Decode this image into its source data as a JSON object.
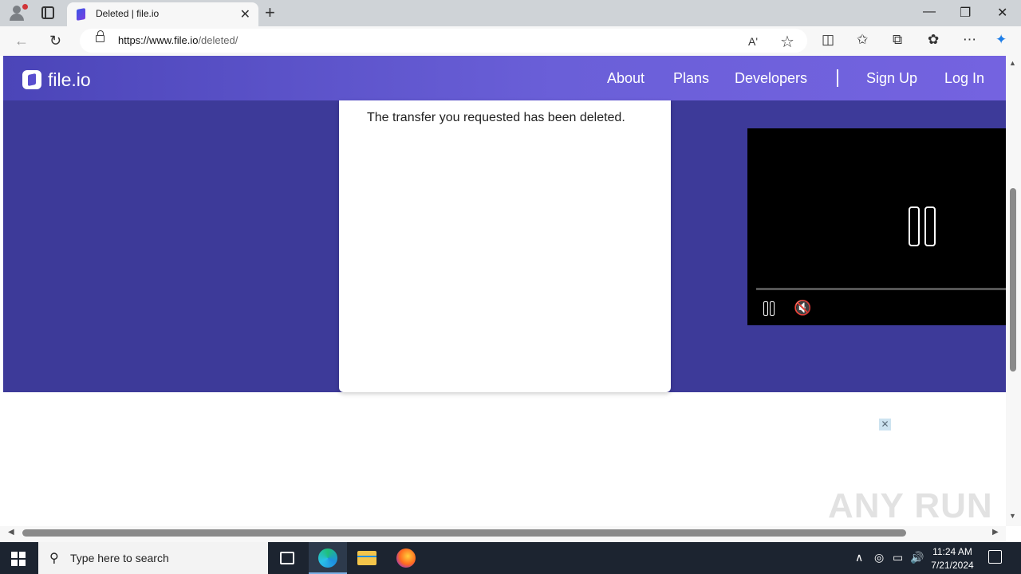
{
  "browser": {
    "tab_title": "Deleted | file.io",
    "tab_close": "✕",
    "new_tab": "+",
    "url_host": "https://www.file.io",
    "url_path": "/deleted/",
    "window_controls": {
      "minimize": "—",
      "restore": "❐",
      "close": "✕"
    },
    "nav": {
      "back": "←",
      "refresh": "↻"
    },
    "toolbar_icons": {
      "read_aloud": "Aʹ",
      "favorite": "☆",
      "split": "◫",
      "favorites": "✩",
      "collections": "⧉",
      "extensions": "✿",
      "menu": "⋯",
      "copilot": "✦"
    }
  },
  "site": {
    "logo_text": "file.io",
    "nav": {
      "about": "About",
      "plans": "Plans",
      "developers": "Developers",
      "signup": "Sign Up",
      "login": "Log In"
    },
    "message": "The transfer you requested has been deleted.",
    "ad_close": "✕",
    "watermark": "ANY RUN"
  },
  "video": {
    "state": "paused",
    "muted": true,
    "mute_icon": "🔇"
  },
  "scrollbar": {
    "up": "▲",
    "down": "▼",
    "left": "◀",
    "right": "▶"
  },
  "taskbar": {
    "search_placeholder": "Type here to search",
    "search_icon": "⚲",
    "tray": {
      "chevron": "∧",
      "meet": "◎",
      "network": "▭",
      "volume": "🔊"
    },
    "time": "11:24 AM",
    "date": "7/21/2024"
  },
  "colors": {
    "hero": "#3d3a99",
    "header_start": "#4b45b8",
    "header_end": "#7463e0",
    "taskbar": "#1c2430"
  }
}
